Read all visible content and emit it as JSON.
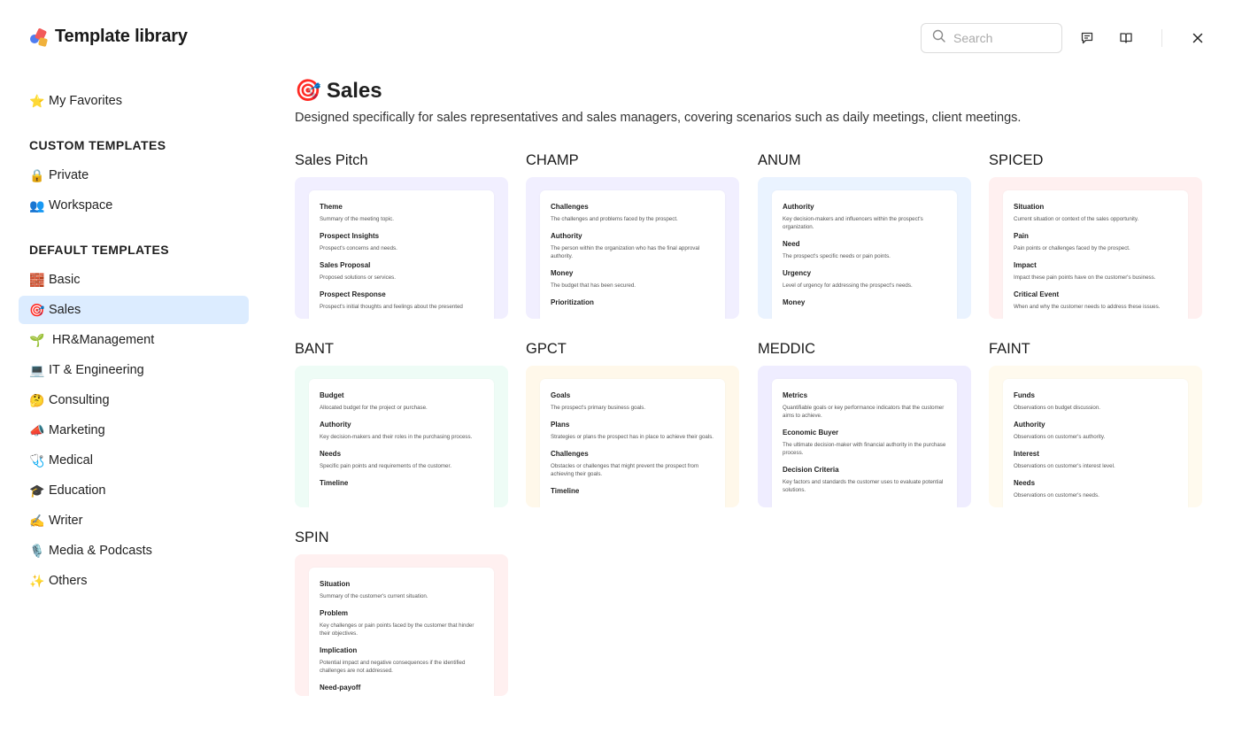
{
  "header": {
    "title": "Template library",
    "search_placeholder": "Search"
  },
  "sidebar": {
    "favorites": {
      "icon": "⭐",
      "label": "My Favorites"
    },
    "custom_heading": "CUSTOM TEMPLATES",
    "custom_items": [
      {
        "icon": "🔒",
        "label": "Private"
      },
      {
        "icon": "👥",
        "label": "Workspace"
      }
    ],
    "default_heading": "DEFAULT TEMPLATES",
    "default_items": [
      {
        "icon": "🧱",
        "label": "Basic"
      },
      {
        "icon": "🎯",
        "label": "Sales"
      },
      {
        "icon": "🌱",
        "label": "HR&Management"
      },
      {
        "icon": "💻",
        "label": "IT & Engineering"
      },
      {
        "icon": "🤔",
        "label": "Consulting"
      },
      {
        "icon": "📣",
        "label": "Marketing"
      },
      {
        "icon": "🩺",
        "label": "Medical"
      },
      {
        "icon": "🎓",
        "label": "Education"
      },
      {
        "icon": "✍️",
        "label": "Writer"
      },
      {
        "icon": "🎙️",
        "label": "Media & Podcasts"
      },
      {
        "icon": "✨",
        "label": "Others"
      }
    ]
  },
  "main": {
    "icon": "🎯",
    "title": "Sales",
    "description": "Designed specifically for sales representatives and sales managers, covering scenarios such as daily meetings, client meetings.",
    "templates": [
      {
        "name": "Sales Pitch",
        "tint": "#f1efff",
        "sections": [
          {
            "h": "Theme",
            "d": "Summary of the meeting topic."
          },
          {
            "h": "Prospect Insights",
            "d": "Prospect's concerns and needs."
          },
          {
            "h": "Sales Proposal",
            "d": "Proposed solutions or services."
          },
          {
            "h": "Prospect Response",
            "d": "Prospect's initial thoughts and feelings about the presented"
          }
        ]
      },
      {
        "name": "CHAMP",
        "tint": "#f1efff",
        "sections": [
          {
            "h": "Challenges",
            "d": "The challenges and problems faced by the prospect."
          },
          {
            "h": "Authority",
            "d": "The person within the organization who has the final approval authority."
          },
          {
            "h": "Money",
            "d": "The budget that has been secured."
          },
          {
            "h": "Prioritization",
            "d": ""
          }
        ]
      },
      {
        "name": "ANUM",
        "tint": "#eaf3ff",
        "sections": [
          {
            "h": "Authority",
            "d": "Key decision-makers and influencers within the prospect's organization."
          },
          {
            "h": "Need",
            "d": "The prospect's specific needs or pain points."
          },
          {
            "h": "Urgency",
            "d": "Level of urgency for addressing the prospect's needs."
          },
          {
            "h": "Money",
            "d": ""
          }
        ]
      },
      {
        "name": "SPICED",
        "tint": "#fff0f0",
        "sections": [
          {
            "h": "Situation",
            "d": "Current situation or context of the sales opportunity."
          },
          {
            "h": "Pain",
            "d": "Pain points or challenges faced by the prospect."
          },
          {
            "h": "Impact",
            "d": "Impact these pain points have on the customer's business."
          },
          {
            "h": "Critical Event",
            "d": "When and why the customer needs to address these issues."
          }
        ]
      },
      {
        "name": "BANT",
        "tint": "#eefcf6",
        "sections": [
          {
            "h": "Budget",
            "d": "Allocated budget for the project or purchase."
          },
          {
            "h": "Authority",
            "d": "Key decision-makers and their roles in the purchasing process."
          },
          {
            "h": "Needs",
            "d": "Specific pain points and requirements of the customer."
          },
          {
            "h": "Timeline",
            "d": ""
          }
        ]
      },
      {
        "name": "GPCT",
        "tint": "#fff8ea",
        "sections": [
          {
            "h": "Goals",
            "d": "The prospect's primary business goals."
          },
          {
            "h": "Plans",
            "d": "Strategies or plans the prospect has in place to achieve their goals."
          },
          {
            "h": "Challenges",
            "d": "Obstacles or challenges that might prevent the prospect from achieving their goals."
          },
          {
            "h": "Timeline",
            "d": ""
          }
        ]
      },
      {
        "name": "MEDDIC",
        "tint": "#efedff",
        "sections": [
          {
            "h": "Metrics",
            "d": "Quantifiable goals or key performance indicators that the customer aims to achieve."
          },
          {
            "h": "Economic Buyer",
            "d": "The ultimate decision-maker with financial authority in the purchase process."
          },
          {
            "h": "Decision Criteria",
            "d": "Key factors and standards the customer uses to evaluate potential solutions."
          }
        ]
      },
      {
        "name": "FAINT",
        "tint": "#fffaee",
        "sections": [
          {
            "h": "Funds",
            "d": "Observations on budget discussion."
          },
          {
            "h": "Authority",
            "d": "Observations on customer's authority."
          },
          {
            "h": "Interest",
            "d": "Observations on customer's interest level."
          },
          {
            "h": "Needs",
            "d": "Observations on customer's needs."
          }
        ]
      },
      {
        "name": "SPIN",
        "tint": "#fff0f0",
        "sections": [
          {
            "h": "Situation",
            "d": "Summary of the customer's current situation."
          },
          {
            "h": "Problem",
            "d": "Key challenges or pain points faced by the customer that hinder their objectives."
          },
          {
            "h": "Implication",
            "d": "Potential impact and negative consequences if the identified challenges are not addressed."
          },
          {
            "h": "Need-payoff",
            "d": ""
          }
        ]
      }
    ]
  }
}
